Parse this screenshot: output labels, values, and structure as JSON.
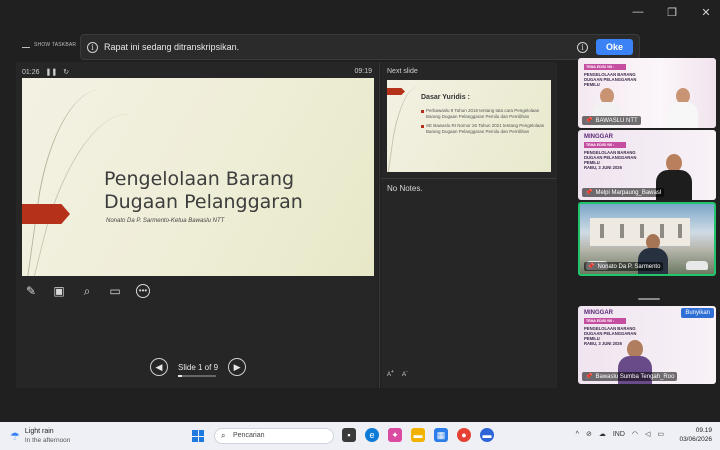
{
  "banner": {
    "message": "Rapat ini sedang ditranskripsikan.",
    "ok_label": "Oke"
  },
  "toolbar": {
    "show_taskbar": "SHOW TASKBAR"
  },
  "presenter": {
    "elapsed": "01:26",
    "clock": "09:19",
    "slide": {
      "title_line1": "Pengelolaan Barang",
      "title_line2": "Dugaan Pelanggaran",
      "subtitle": "Nonato Da P. Sarmento-Ketua Bawaslu NTT"
    },
    "slide_counter": "Slide 1 of 9",
    "slide_progress": 0.11
  },
  "next": {
    "header": "Next slide",
    "title": "Dasar Yuridis :",
    "bullets": [
      "Perbawaslu 9 Tahun 2018 tentang tata cara Pengelolaan Barang Dugaan Pelanggaran Pemilu dan Pemilihan",
      "SE Bawaslu RI Nomor 26 Tahun 2021 tentang Pengelolaan Barang Dugaan Pelanggaran Pemilu dan Pemilihan"
    ],
    "notes": "No Notes."
  },
  "participants": [
    {
      "name": "BAWASLU NTT"
    },
    {
      "name": "Melpi Marpaung_Bawasl"
    },
    {
      "name": "Nonato Da P. Sarmento"
    },
    {
      "name": "Bawaslu Sumba Tengah_Roo"
    }
  ],
  "poster": {
    "brand": "MINGGAR",
    "tema": "TEMA EDISI VIII :",
    "topic": "PENGELOLAAN BARANG DUGAAN PELANGGARAN PEMILU",
    "date": "RABU, 3 JUNI 2026",
    "logo": "BAWASLU"
  },
  "speaker_badge": "Bunyikan",
  "taskbar": {
    "weather_title": "Light rain",
    "weather_sub": "In the afternoon",
    "search_placeholder": "Pencarian",
    "lang": "IND",
    "time": "09.19",
    "date": "03/06/2026"
  }
}
